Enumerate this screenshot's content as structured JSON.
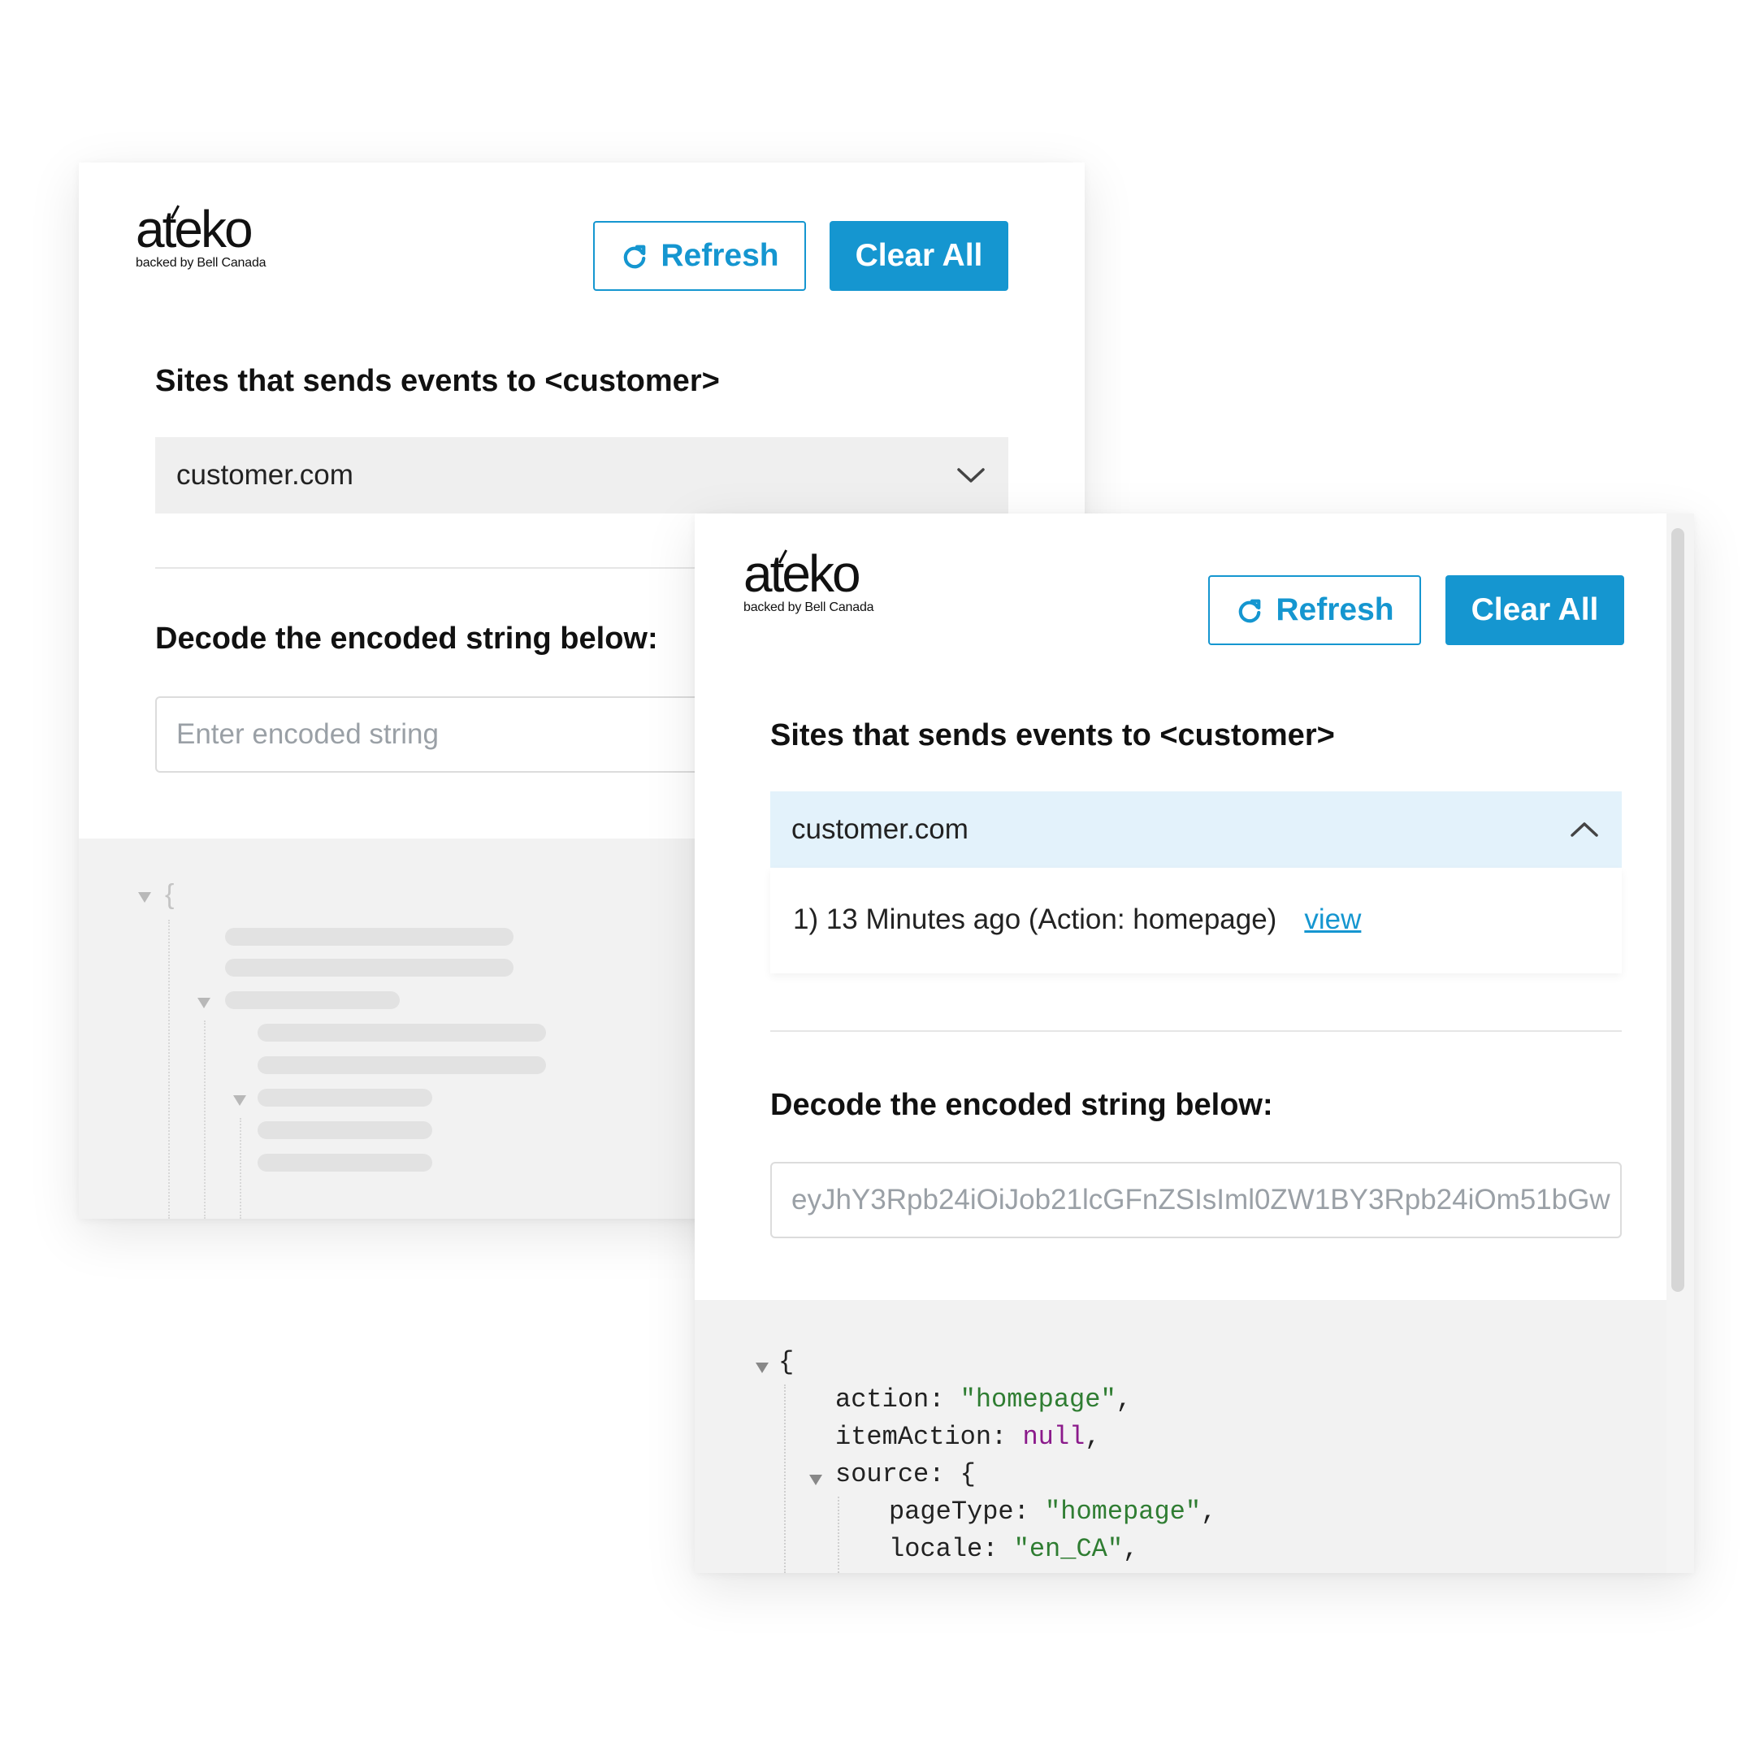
{
  "brand": {
    "logo_text": "ateko",
    "tagline": "backed by Bell Canada"
  },
  "toolbar": {
    "refresh_label": "Refresh",
    "clear_label": "Clear All"
  },
  "sites": {
    "heading": "Sites that sends events to <customer>",
    "selected": "customer.com"
  },
  "events": [
    {
      "text": "1) 13  Minutes ago (Action: homepage)",
      "link": "view"
    }
  ],
  "decode": {
    "heading": "Decode the encoded string below:",
    "placeholder": "Enter encoded string",
    "value": "eyJhY3Rpb24iOiJob21lcGFnZSIsIml0ZW1BY3Rpb24iOm51bGw"
  },
  "json_view": {
    "open_brace": "{",
    "lines": [
      {
        "key": "action",
        "value": "\"homepage\"",
        "kind": "string",
        "suffix": ","
      },
      {
        "key": "itemAction",
        "value": "null",
        "kind": "null",
        "suffix": ","
      },
      {
        "key": "source",
        "value": "{",
        "kind": "object",
        "suffix": ""
      },
      {
        "key": "pageType",
        "value": "\"homepage\"",
        "kind": "string",
        "suffix": ","
      },
      {
        "key": "locale",
        "value": "\"en_CA\"",
        "kind": "string",
        "suffix": ","
      }
    ]
  },
  "colors": {
    "accent": "#1596d0",
    "string_value": "#2f7d32",
    "null_value": "#8b1a8b",
    "selected_bg": "#e3f2fb",
    "collapsed_bg": "#efefef"
  }
}
